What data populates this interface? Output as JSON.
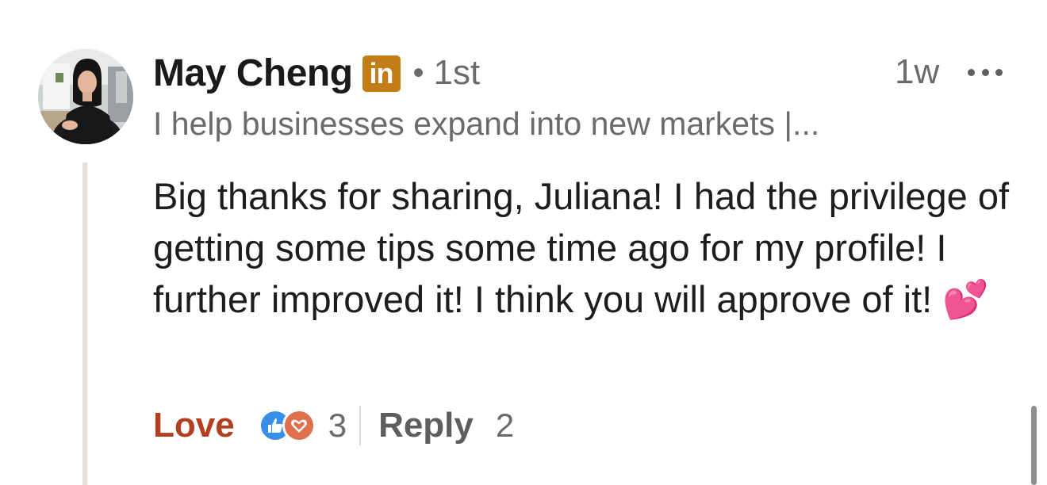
{
  "comment": {
    "author": {
      "name": "May Cheng",
      "badge_text": "in",
      "separator": "•",
      "degree": "1st",
      "headline": "I help businesses expand into new markets |..."
    },
    "timestamp": "1w",
    "body": "Big thanks for sharing, Juliana! I had the privilege of getting some tips some time ago for my profile! I further improved it! I think you will approve of it! 💕",
    "actions": {
      "reaction_label": "Love",
      "reaction_icons": [
        "like-icon",
        "love-icon"
      ],
      "reaction_count": "3",
      "reply_label": "Reply",
      "reply_count": "2"
    }
  },
  "colors": {
    "reaction_active": "#b24020",
    "premium_badge": "#c37d16",
    "like_blue": "#378fe9",
    "love_orange": "#df704d",
    "muted_text": "#6b6b6b"
  }
}
